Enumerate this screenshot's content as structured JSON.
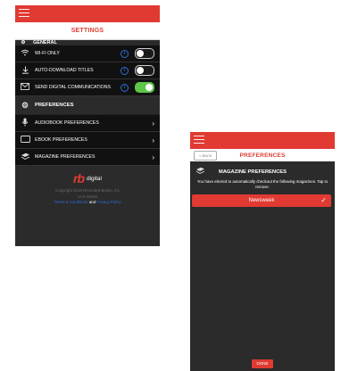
{
  "colors": {
    "accent": "#e03a32",
    "dark_bg": "#2b2b2b",
    "row_bg": "#111111",
    "toggle_on": "#5ec54a",
    "info_blue": "#2d6fd8"
  },
  "settings_screen": {
    "title": "SETTINGS",
    "general_section": "GENERAL",
    "rows": [
      {
        "icon": "wifi-icon",
        "label": "WI-FI ONLY",
        "toggle": "off"
      },
      {
        "icon": "download-icon",
        "label": "AUTO-DOWNLOAD TITLES",
        "toggle": "off"
      },
      {
        "icon": "mail-icon",
        "label": "SEND DIGITAL COMMUNICATIONS",
        "toggle": "on"
      }
    ],
    "preferences_section": "PREFERENCES",
    "preference_rows": [
      {
        "icon": "microphone-icon",
        "label": "AUDIOBOOK PREFERENCES"
      },
      {
        "icon": "tablet-icon",
        "label": "EBOOK PREFERENCES"
      },
      {
        "icon": "magazine-icon",
        "label": "MAGAZINE PREFERENCES"
      }
    ],
    "footer": {
      "logo_mark": "rb",
      "logo_word": "digital",
      "copyright": "Copyright 2018 Recorded Books, Inc",
      "version": "v4.6.3e629",
      "link1": "Terms & Conditions",
      "link_joiner": "and",
      "link2": "Privacy Policy"
    }
  },
  "magazine_screen": {
    "back_label": "< BACK",
    "title": "PREFERENCES",
    "section_title": "MAGAZINE PREFERENCES",
    "description": "You have elected to automatically checkout the following magazines. Tap to remove.",
    "items": [
      {
        "label": "Newsweek",
        "selected": true
      }
    ],
    "done_label": "DONE"
  }
}
